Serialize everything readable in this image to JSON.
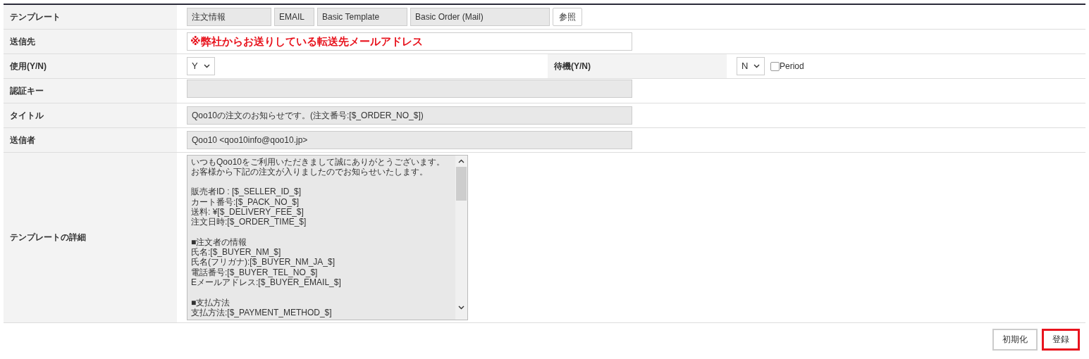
{
  "form": {
    "template": {
      "label": "テンプレート",
      "parts": [
        "注文情報",
        "EMAIL",
        "Basic Template",
        "Basic Order (Mail)"
      ],
      "browse_button": "参照"
    },
    "recipient": {
      "label": "送信先",
      "value": "※弊社からお送りしている転送先メールアドレス"
    },
    "usage": {
      "label": "使用(Y/N)",
      "value": "Y"
    },
    "standby": {
      "label": "待機(Y/N)",
      "value": "N",
      "period": {
        "label": "Period",
        "checked": false
      }
    },
    "auth_key": {
      "label": "認証キー"
    },
    "subject": {
      "label": "タイトル",
      "value": "Qoo10の注文のお知らせです。(注文番号:[$_ORDER_NO_$])"
    },
    "sender": {
      "label": "送信者",
      "value": "Qoo10 <qoo10info@qoo10.jp>"
    },
    "body": {
      "label": "テンプレートの詳細",
      "paragraphs": [
        [
          "いつもQoo10をご利用いただきまして誠にありがとうございます。",
          "お客様から下記の注文が入りましたのでお知らせいたします。"
        ],
        [
          "販売者ID : [$_SELLER_ID_$]",
          "カート番号:[$_PACK_NO_$]",
          "送料: ¥[$_DELIVERY_FEE_$]",
          "注文日時:[$_ORDER_TIME_$]"
        ],
        [
          "■注文者の情報",
          "氏名:[$_BUYER_NM_$]",
          "氏名(フリガナ):[$_BUYER_NM_JA_$]",
          "電話番号:[$_BUYER_TEL_NO_$]",
          "Eメールアドレス:[$_BUYER_EMAIL_$]"
        ],
        [
          "■支払方法",
          "支払方法:[$_PAYMENT_METHOD_$]"
        ]
      ]
    }
  },
  "buttons": [
    {
      "label": "初期化",
      "highlighted": false
    },
    {
      "label": "登録",
      "highlighted": true
    }
  ]
}
